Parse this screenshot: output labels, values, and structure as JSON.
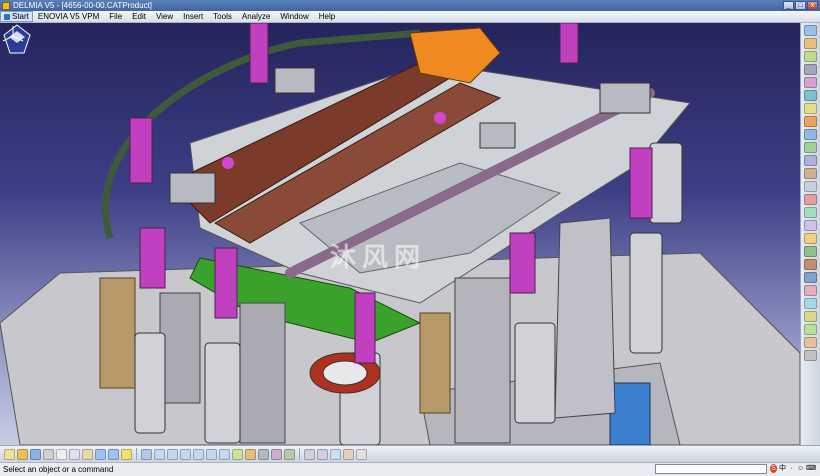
{
  "window": {
    "title": "DELMIA V5 - [4656-00-00.CATProduct]",
    "minimize_label": "_",
    "maximize_label": "□",
    "close_label": "x"
  },
  "menubar": {
    "items": [
      {
        "label": "Start"
      },
      {
        "label": "ENOVIA V5 VPM"
      },
      {
        "label": "File"
      },
      {
        "label": "Edit"
      },
      {
        "label": "View"
      },
      {
        "label": "Insert"
      },
      {
        "label": "Tools"
      },
      {
        "label": "Analyze"
      },
      {
        "label": "Window"
      },
      {
        "label": "Help"
      }
    ]
  },
  "viewport": {
    "watermark": "沐风网"
  },
  "status": {
    "text": "Select an object or a command",
    "command_value": ""
  },
  "tray": {
    "ime_label": "中"
  },
  "colors": {
    "background_top": "#25245c",
    "background_bottom": "#c9cce3",
    "clamp_magenta": "#c040c0",
    "panel_brown": "#7a3b2a",
    "panel_green": "#3aa22a",
    "bracket_orange": "#f08a20",
    "base_gray": "#c8c8cc"
  }
}
